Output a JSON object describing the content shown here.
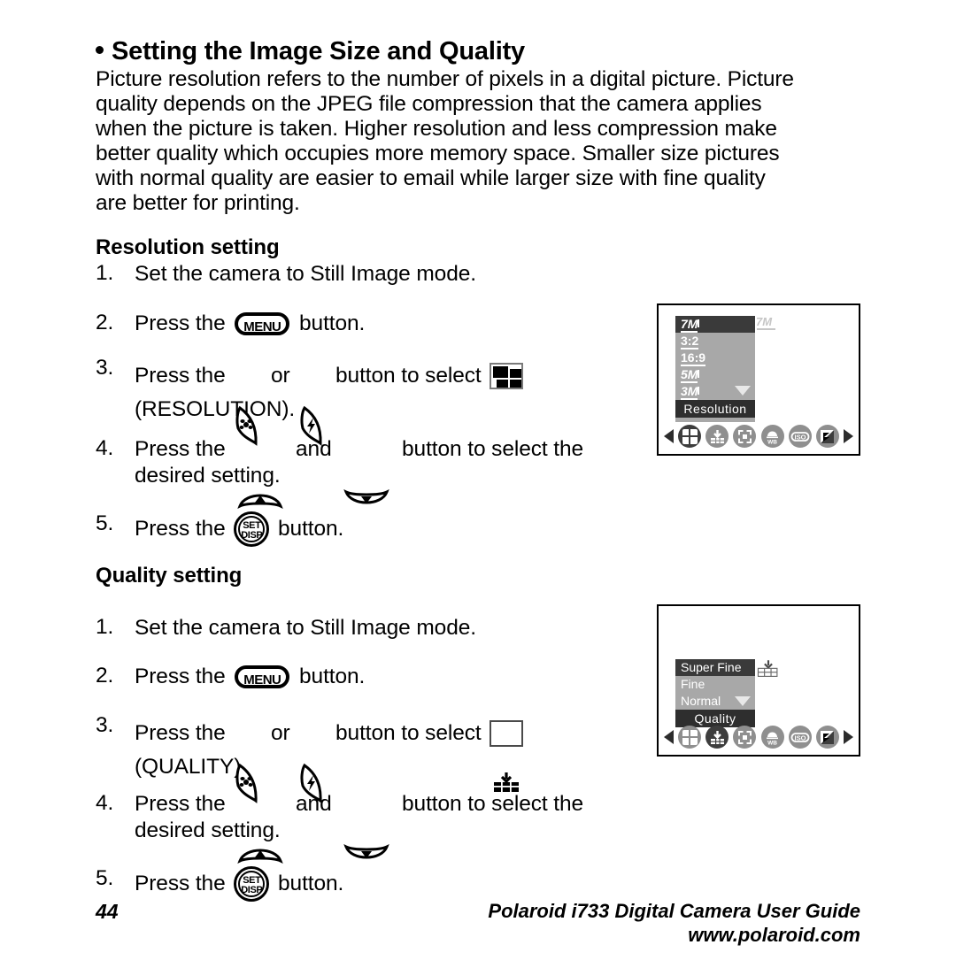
{
  "document": {
    "section_title": "Setting the Image Size and Quality",
    "intro_lines": [
      "Picture resolution refers to the number of pixels in a digital picture. Picture",
      "quality depends on the JPEG file compression that the camera applies",
      "when the picture is taken. Higher resolution and less compression make",
      "better quality which occupies more memory space. Smaller size pictures",
      "with normal quality are easier to email while larger size with fine quality",
      "are better for printing."
    ]
  },
  "resolution_section": {
    "heading": "Resolution setting",
    "steps": [
      {
        "number": "1.",
        "text": "Set the camera to Still Image mode."
      },
      {
        "number": "2.",
        "before": "Press the ",
        "button": "MENU",
        "after": " button."
      },
      {
        "number": "3.",
        "before": "Press the ",
        "mid": " or ",
        "after": " button to select ",
        "continuation": "(RESOLUTION)."
      },
      {
        "number": "4.",
        "before": "Press the ",
        "mid": " and ",
        "after": " button to select the",
        "continuation": "desired setting."
      },
      {
        "number": "5.",
        "before": "Press the ",
        "after": " button."
      }
    ]
  },
  "quality_section": {
    "heading": "Quality setting",
    "steps": [
      {
        "number": "1.",
        "text": "Set the camera to Still Image mode."
      },
      {
        "number": "2.",
        "before": "Press the ",
        "button": "MENU",
        "after": " button."
      },
      {
        "number": "3.",
        "before": "Press the ",
        "mid": " or ",
        "after": " button to select ",
        "continuation": "(QUALITY)."
      },
      {
        "number": "4.",
        "before": "Press the ",
        "mid": " and ",
        "after": " button to select the",
        "continuation": "desired setting."
      },
      {
        "number": "5.",
        "before": "Press the ",
        "after": " button."
      }
    ]
  },
  "buttons": {
    "menu_label": "MENU",
    "set_label": "SET",
    "disp_label": "DISP"
  },
  "resolution_screen": {
    "menu_items": [
      {
        "label": "7M",
        "selected": true
      },
      {
        "label": "3:2",
        "selected": false
      },
      {
        "label": "16:9",
        "selected": false
      },
      {
        "label": "5M",
        "selected": false
      },
      {
        "label": "3M",
        "selected": false
      }
    ],
    "title": "Resolution",
    "corner_indicator": "7M",
    "strip_icons": [
      "resolution-grid-icon",
      "quality-icon",
      "focus-icon",
      "white-balance-icon",
      "iso-icon",
      "exposure-icon"
    ],
    "active_strip_icon": "resolution-grid-icon"
  },
  "quality_screen": {
    "menu_items": [
      {
        "label": "Super Fine",
        "selected": true
      },
      {
        "label": "Fine",
        "selected": false
      },
      {
        "label": "Normal",
        "selected": false
      }
    ],
    "title": "Quality",
    "strip_icons": [
      "resolution-grid-icon",
      "quality-icon",
      "focus-icon",
      "white-balance-icon",
      "iso-icon",
      "exposure-icon"
    ],
    "active_strip_icon": "quality-icon"
  },
  "footer": {
    "page_number": "44",
    "guide_title": "Polaroid i733 Digital Camera User Guide",
    "website": "www.polaroid.com"
  },
  "colors": {
    "panel_bg": "#a8a8a8",
    "panel_selected": "#3a3a3a",
    "panel_title": "#2e2e2e",
    "icon_inactive": "#8f8f8f",
    "icon_active": "#3d3d3d"
  }
}
